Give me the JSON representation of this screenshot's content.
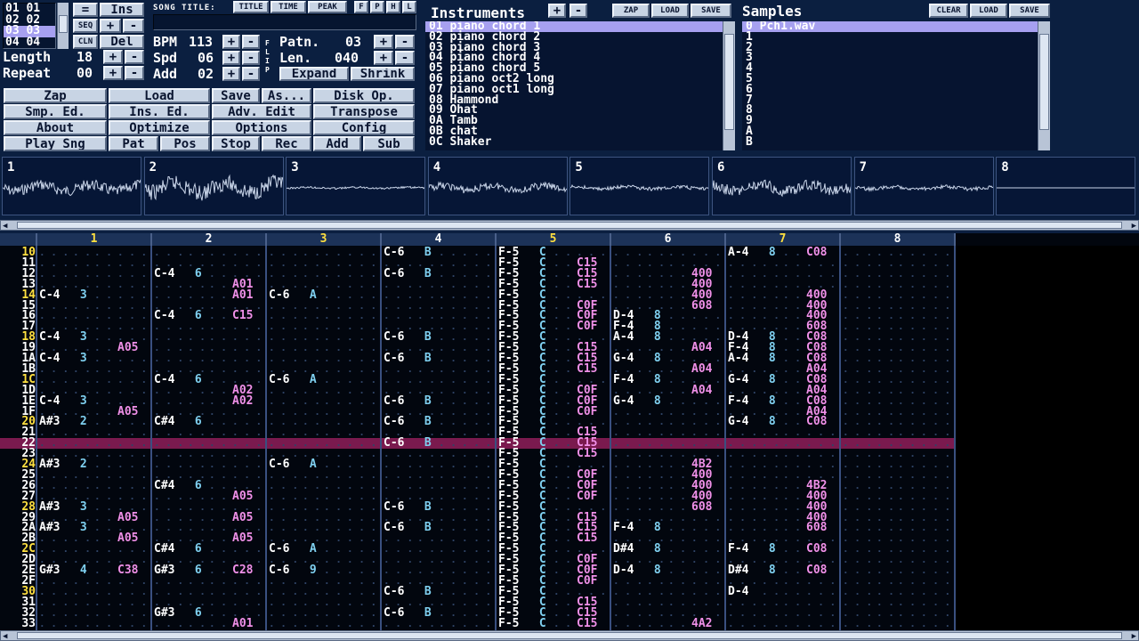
{
  "app": {
    "song_title_label": "SONG TITLE:",
    "title_btn": "TITLE",
    "time_btn": "TIME",
    "peak_btn": "PEAK",
    "ctrl_f": "F",
    "ctrl_p": "P",
    "ctrl_h": "H",
    "ctrl_l": "L"
  },
  "order": {
    "rows": [
      [
        "01",
        "01"
      ],
      [
        "02",
        "02"
      ],
      [
        "03",
        "03"
      ],
      [
        "04",
        "04"
      ]
    ],
    "selected_row": 2,
    "eq": "=",
    "ins": "Ins",
    "seq": "SEQ",
    "plus": "+",
    "minus": "-",
    "cln": "CLN",
    "del": "Del"
  },
  "song": {
    "length_label": "Length",
    "length_value": "18",
    "repeat_label": "Repeat",
    "repeat_value": "00",
    "bpm_label": "BPM",
    "bpm_value": "113",
    "spd_label": "Spd",
    "spd_value": "06",
    "add_label": "Add",
    "add_value": "02",
    "flip": "FLIP"
  },
  "pattern": {
    "patn_label": "Patn.",
    "patn_value": "03",
    "len_label": "Len.",
    "len_value": "040",
    "expand": "Expand",
    "shrink": "Shrink"
  },
  "menu": [
    "Zap",
    "Load",
    "Save",
    "As...",
    "Disk Op.",
    "Smp. Ed.",
    "Ins. Ed.",
    "Adv. Edit",
    "Transpose",
    "About",
    "Optimize",
    "Options",
    "Config",
    "Play Sng",
    "Pat",
    "Pos",
    "Stop",
    "Rec",
    "Add",
    "Sub"
  ],
  "instruments": {
    "title": "Instruments",
    "zap": "ZAP",
    "load": "LOAD",
    "save": "SAVE",
    "selected": 0,
    "items": [
      "01 piano chord 1",
      "02 piano chord 2",
      "03 piano chord 3",
      "04 piano chord 4",
      "05 piano chord 5",
      "06 piano oct2 long",
      "07 piano oct1 long",
      "08 Hammond",
      "09 Ohat",
      "0A Tamb",
      "0B chat",
      "0C Shaker"
    ]
  },
  "samples": {
    "title": "Samples",
    "clear": "CLEAR",
    "load": "LOAD",
    "save": "SAVE",
    "selected": 0,
    "items": [
      "0 Pch1.wav",
      "1",
      "2",
      "3",
      "4",
      "5",
      "6",
      "7",
      "8",
      "9",
      "A",
      "B"
    ]
  },
  "scopes": [
    "1",
    "2",
    "3",
    "4",
    "5",
    "6",
    "7",
    "8"
  ],
  "channels": [
    "1",
    "2",
    "3",
    "4",
    "5",
    "6",
    "7",
    "8"
  ],
  "current_row": "22",
  "pattern_rows": [
    {
      "r": "10",
      "c": [
        [],
        [],
        [],
        [
          "C-6",
          "B"
        ],
        [
          "F-5",
          "C"
        ],
        [],
        [
          "A-4",
          "8",
          "",
          "C08"
        ],
        []
      ]
    },
    {
      "r": "11",
      "c": [
        [],
        [],
        [],
        [],
        [
          "F-5",
          "C",
          "",
          "C15"
        ],
        [],
        [],
        []
      ]
    },
    {
      "r": "12",
      "c": [
        [],
        [
          "C-4",
          "6"
        ],
        [],
        [
          "C-6",
          "B"
        ],
        [
          "F-5",
          "C",
          "",
          "C15"
        ],
        [
          "",
          "",
          "",
          "400"
        ],
        [],
        []
      ]
    },
    {
      "r": "13",
      "c": [
        [],
        [
          "",
          "",
          "",
          "A01"
        ],
        [],
        [],
        [
          "F-5",
          "C",
          "",
          "C15"
        ],
        [
          "",
          "",
          "",
          "400"
        ],
        [],
        []
      ]
    },
    {
      "r": "14",
      "c": [
        [
          "C-4",
          "3"
        ],
        [
          "",
          "",
          "",
          "A01"
        ],
        [
          "C-6",
          "A"
        ],
        [],
        [
          "F-5",
          "C"
        ],
        [
          "",
          "",
          "",
          "400"
        ],
        [
          "",
          "",
          "",
          "400"
        ],
        []
      ]
    },
    {
      "r": "15",
      "c": [
        [],
        [],
        [],
        [],
        [
          "F-5",
          "C",
          "",
          "C0F"
        ],
        [
          "",
          "",
          "",
          "608"
        ],
        [
          "",
          "",
          "",
          "400"
        ],
        []
      ]
    },
    {
      "r": "16",
      "c": [
        [],
        [
          "C-4",
          "6",
          "",
          "C15"
        ],
        [],
        [],
        [
          "F-5",
          "C",
          "",
          "C0F"
        ],
        [
          "D-4",
          "8"
        ],
        [
          "",
          "",
          "",
          "400"
        ],
        []
      ]
    },
    {
      "r": "17",
      "c": [
        [],
        [],
        [],
        [],
        [
          "F-5",
          "C",
          "",
          "C0F"
        ],
        [
          "F-4",
          "8"
        ],
        [
          "",
          "",
          "",
          "608"
        ],
        []
      ]
    },
    {
      "r": "18",
      "c": [
        [
          "C-4",
          "3"
        ],
        [],
        [],
        [
          "C-6",
          "B"
        ],
        [
          "F-5",
          "C"
        ],
        [
          "A-4",
          "8"
        ],
        [
          "D-4",
          "8",
          "",
          "C08"
        ],
        []
      ]
    },
    {
      "r": "19",
      "c": [
        [
          "",
          "",
          "",
          "A05"
        ],
        [],
        [],
        [],
        [
          "F-5",
          "C",
          "",
          "C15"
        ],
        [
          "",
          "",
          "",
          "A04"
        ],
        [
          "F-4",
          "8",
          "",
          "C08"
        ],
        []
      ]
    },
    {
      "r": "1A",
      "c": [
        [
          "C-4",
          "3"
        ],
        [],
        [],
        [
          "C-6",
          "B"
        ],
        [
          "F-5",
          "C",
          "",
          "C15"
        ],
        [
          "G-4",
          "8"
        ],
        [
          "A-4",
          "8",
          "",
          "C08"
        ],
        []
      ]
    },
    {
      "r": "1B",
      "c": [
        [],
        [],
        [],
        [],
        [
          "F-5",
          "C",
          "",
          "C15"
        ],
        [
          "",
          "",
          "",
          "A04"
        ],
        [
          "",
          "",
          "",
          "A04"
        ],
        []
      ]
    },
    {
      "r": "1C",
      "c": [
        [],
        [
          "C-4",
          "6"
        ],
        [
          "C-6",
          "A"
        ],
        [],
        [
          "F-5",
          "C"
        ],
        [
          "F-4",
          "8"
        ],
        [
          "G-4",
          "8",
          "",
          "C08"
        ],
        []
      ]
    },
    {
      "r": "1D",
      "c": [
        [],
        [
          "",
          "",
          "",
          "A02"
        ],
        [],
        [],
        [
          "F-5",
          "C",
          "",
          "C0F"
        ],
        [
          "",
          "",
          "",
          "A04"
        ],
        [
          "",
          "",
          "",
          "A04"
        ],
        []
      ]
    },
    {
      "r": "1E",
      "c": [
        [
          "C-4",
          "3"
        ],
        [
          "",
          "",
          "",
          "A02"
        ],
        [],
        [
          "C-6",
          "B"
        ],
        [
          "F-5",
          "C",
          "",
          "C0F"
        ],
        [
          "G-4",
          "8"
        ],
        [
          "F-4",
          "8",
          "",
          "C08"
        ],
        []
      ]
    },
    {
      "r": "1F",
      "c": [
        [
          "",
          "",
          "",
          "A05"
        ],
        [],
        [],
        [],
        [
          "F-5",
          "C",
          "",
          "C0F"
        ],
        [],
        [
          "",
          "",
          "",
          "A04"
        ],
        []
      ]
    },
    {
      "r": "20",
      "c": [
        [
          "A#3",
          "2"
        ],
        [
          "C#4",
          "6"
        ],
        [],
        [
          "C-6",
          "B"
        ],
        [
          "F-5",
          "C"
        ],
        [],
        [
          "G-4",
          "8",
          "",
          "C08"
        ],
        []
      ]
    },
    {
      "r": "21",
      "c": [
        [],
        [],
        [],
        [],
        [
          "F-5",
          "C",
          "",
          "C15"
        ],
        [],
        [],
        []
      ]
    },
    {
      "r": "22",
      "c": [
        [],
        [],
        [],
        [
          "C-6",
          "B"
        ],
        [
          "F-5",
          "C",
          "",
          "C15"
        ],
        [],
        [],
        []
      ]
    },
    {
      "r": "23",
      "c": [
        [],
        [],
        [],
        [],
        [
          "F-5",
          "C",
          "",
          "C15"
        ],
        [],
        [],
        []
      ]
    },
    {
      "r": "24",
      "c": [
        [
          "A#3",
          "2"
        ],
        [],
        [
          "C-6",
          "A"
        ],
        [],
        [
          "F-5",
          "C"
        ],
        [
          "",
          "",
          "",
          "4B2"
        ],
        [],
        []
      ]
    },
    {
      "r": "25",
      "c": [
        [],
        [],
        [],
        [],
        [
          "F-5",
          "C",
          "",
          "C0F"
        ],
        [
          "",
          "",
          "",
          "400"
        ],
        [],
        []
      ]
    },
    {
      "r": "26",
      "c": [
        [],
        [
          "C#4",
          "6"
        ],
        [],
        [],
        [
          "F-5",
          "C",
          "",
          "C0F"
        ],
        [
          "",
          "",
          "",
          "400"
        ],
        [
          "",
          "",
          "",
          "4B2"
        ],
        []
      ]
    },
    {
      "r": "27",
      "c": [
        [],
        [
          "",
          "",
          "",
          "A05"
        ],
        [],
        [],
        [
          "F-5",
          "C",
          "",
          "C0F"
        ],
        [
          "",
          "",
          "",
          "400"
        ],
        [
          "",
          "",
          "",
          "400"
        ],
        []
      ]
    },
    {
      "r": "28",
      "c": [
        [
          "A#3",
          "3"
        ],
        [],
        [],
        [
          "C-6",
          "B"
        ],
        [
          "F-5",
          "C"
        ],
        [
          "",
          "",
          "",
          "608"
        ],
        [
          "",
          "",
          "",
          "400"
        ],
        []
      ]
    },
    {
      "r": "29",
      "c": [
        [
          "",
          "",
          "",
          "A05"
        ],
        [
          "",
          "",
          "",
          "A05"
        ],
        [],
        [],
        [
          "F-5",
          "C",
          "",
          "C15"
        ],
        [],
        [
          "",
          "",
          "",
          "400"
        ],
        []
      ]
    },
    {
      "r": "2A",
      "c": [
        [
          "A#3",
          "3"
        ],
        [],
        [],
        [
          "C-6",
          "B"
        ],
        [
          "F-5",
          "C",
          "",
          "C15"
        ],
        [
          "F-4",
          "8"
        ],
        [
          "",
          "",
          "",
          "608"
        ],
        []
      ]
    },
    {
      "r": "2B",
      "c": [
        [
          "",
          "",
          "",
          "A05"
        ],
        [
          "",
          "",
          "",
          "A05"
        ],
        [],
        [],
        [
          "F-5",
          "C",
          "",
          "C15"
        ],
        [],
        [],
        []
      ]
    },
    {
      "r": "2C",
      "c": [
        [],
        [
          "C#4",
          "6"
        ],
        [
          "C-6",
          "A"
        ],
        [],
        [
          "F-5",
          "C"
        ],
        [
          "D#4",
          "8"
        ],
        [
          "F-4",
          "8",
          "",
          "C08"
        ],
        []
      ]
    },
    {
      "r": "2D",
      "c": [
        [],
        [],
        [],
        [],
        [
          "F-5",
          "C",
          "",
          "C0F"
        ],
        [],
        [],
        []
      ]
    },
    {
      "r": "2E",
      "c": [
        [
          "G#3",
          "4",
          "",
          "C38"
        ],
        [
          "G#3",
          "6",
          "",
          "C28"
        ],
        [
          "C-6",
          "9"
        ],
        [],
        [
          "F-5",
          "C",
          "",
          "C0F"
        ],
        [
          "D-4",
          "8"
        ],
        [
          "D#4",
          "8",
          "",
          "C08"
        ],
        []
      ]
    },
    {
      "r": "2F",
      "c": [
        [],
        [],
        [],
        [],
        [
          "F-5",
          "C",
          "",
          "C0F"
        ],
        [],
        [],
        []
      ]
    },
    {
      "r": "30",
      "c": [
        [],
        [],
        [],
        [
          "C-6",
          "B"
        ],
        [
          "F-5",
          "C"
        ],
        [],
        [
          "D-4"
        ],
        []
      ]
    },
    {
      "r": "31",
      "c": [
        [],
        [],
        [],
        [],
        [
          "F-5",
          "C",
          "",
          "C15"
        ],
        [],
        [],
        []
      ]
    },
    {
      "r": "32",
      "c": [
        [],
        [
          "G#3",
          "6"
        ],
        [],
        [
          "C-6",
          "B"
        ],
        [
          "F-5",
          "C",
          "",
          "C15"
        ],
        [],
        [],
        []
      ]
    },
    {
      "r": "33",
      "c": [
        [],
        [
          "",
          "",
          "",
          "A01"
        ],
        [],
        [],
        [
          "F-5",
          "C",
          "",
          "C15"
        ],
        [
          "",
          "",
          "",
          "4A2"
        ],
        [],
        []
      ]
    }
  ]
}
